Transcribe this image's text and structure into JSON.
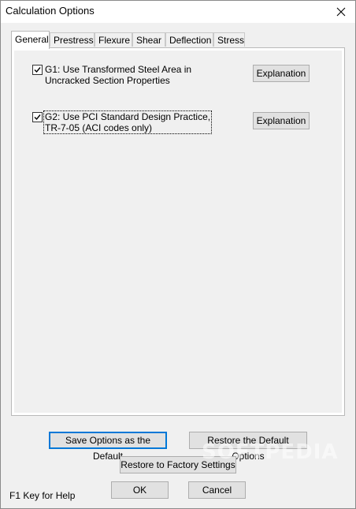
{
  "window": {
    "title": "Calculation Options"
  },
  "tabs": [
    {
      "label": "General",
      "active": true
    },
    {
      "label": "Prestress",
      "active": false
    },
    {
      "label": "Flexure",
      "active": false
    },
    {
      "label": "Shear",
      "active": false
    },
    {
      "label": "Deflection",
      "active": false
    },
    {
      "label": "Stress",
      "active": false
    }
  ],
  "options": [
    {
      "checked": true,
      "line1": "G1: Use Transformed Steel Area in",
      "line2": "Uncracked Section Properties",
      "explain_label": "Explanation"
    },
    {
      "checked": true,
      "line1": "G2: Use PCI Standard Design Practice,",
      "line2": "TR-7-05 (ACI codes only)",
      "explain_label": "Explanation"
    }
  ],
  "buttons": {
    "save_default": "Save Options as the Default",
    "restore_default": "Restore the Default Options",
    "restore_factory": "Restore to Factory Settings",
    "ok": "OK",
    "cancel": "Cancel"
  },
  "help_text": "F1 Key for Help",
  "watermark": "SOFTPEDIA"
}
